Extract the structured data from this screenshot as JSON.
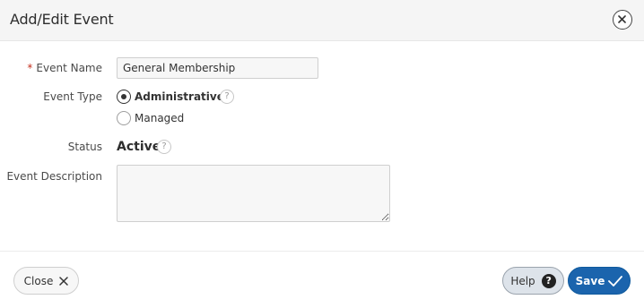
{
  "dialog": {
    "title": "Add/Edit Event",
    "close_icon": "close-circle-icon"
  },
  "form": {
    "event_name": {
      "required_marker": "*",
      "label": "Event Name",
      "value": "General Membership"
    },
    "event_type": {
      "label": "Event Type",
      "options": [
        {
          "label": "Administrative",
          "selected": true
        },
        {
          "label": "Managed",
          "selected": false
        }
      ],
      "help_glyph": "?"
    },
    "status": {
      "label": "Status",
      "value": "Active",
      "help_glyph": "?"
    },
    "event_description": {
      "label": "Event Description",
      "value": ""
    }
  },
  "footer": {
    "close_label": "Close",
    "help_label": "Help",
    "help_glyph": "?",
    "save_label": "Save"
  },
  "colors": {
    "save_button": "#1b64ad",
    "required_marker": "#c4301f"
  }
}
